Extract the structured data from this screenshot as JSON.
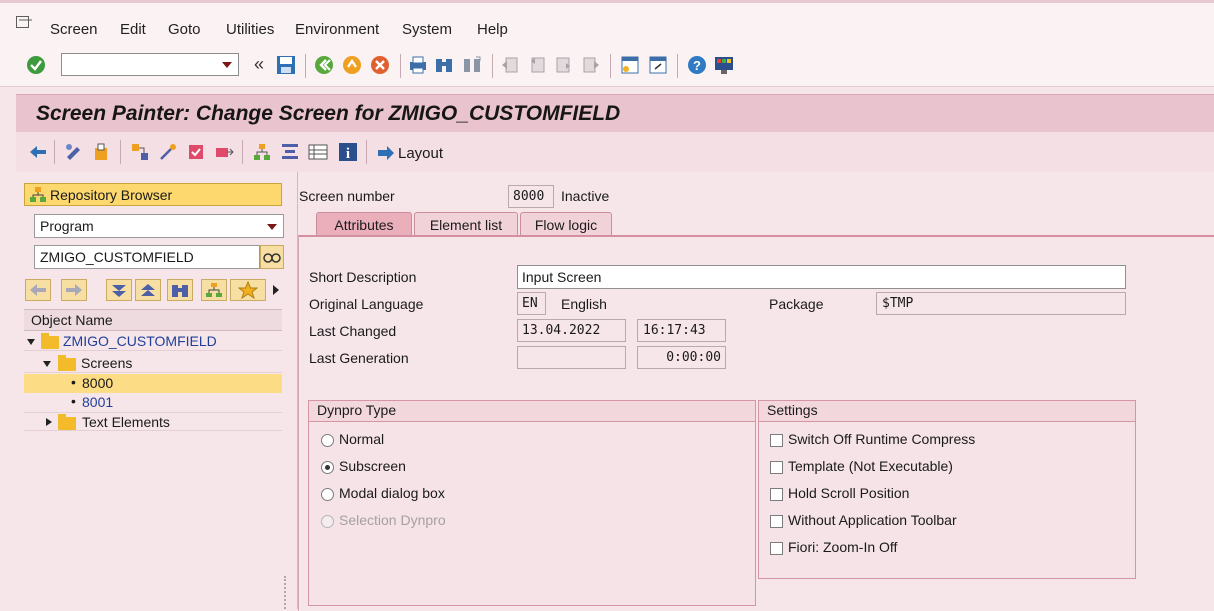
{
  "menu": {
    "items": [
      "Screen",
      "Edit",
      "Goto",
      "Utilities",
      "Environment",
      "System",
      "Help"
    ]
  },
  "system_toolbar": {
    "command_field_value": "",
    "icons": [
      "enter-icon",
      "save-icon",
      "back-icon",
      "exit-icon",
      "cancel-icon",
      "print-icon",
      "find-icon",
      "find-next-icon",
      "first-page-icon",
      "previous-page-icon",
      "next-page-icon",
      "last-page-icon",
      "new-session-icon",
      "shortcut-icon",
      "help-icon",
      "customize-layout-icon"
    ]
  },
  "title": "Screen Painter: Change Screen for ZMIGO_CUSTOMFIELD",
  "app_toolbar": {
    "layout_label": "Layout"
  },
  "left_panel": {
    "repository_browser_label": "Repository Browser",
    "object_type": "Program",
    "object_name_value": "ZMIGO_CUSTOMFIELD",
    "column_header": "Object Name",
    "tree": {
      "root": "ZMIGO_CUSTOMFIELD",
      "screens_label": "Screens",
      "screens": [
        "8000",
        "8001"
      ],
      "text_elements_label": "Text Elements"
    }
  },
  "screen": {
    "number_label": "Screen number",
    "number": "8000",
    "status": "Inactive"
  },
  "tabs": [
    "Attributes",
    "Element list",
    "Flow logic"
  ],
  "attributes": {
    "short_description_label": "Short Description",
    "short_description": "Input Screen",
    "original_language_label": "Original Language",
    "language_code": "EN",
    "language_name": "English",
    "package_label": "Package",
    "package": "$TMP",
    "last_changed_label": "Last Changed",
    "last_changed_date": "13.04.2022",
    "last_changed_time": "16:17:43",
    "last_generation_label": "Last Generation",
    "last_generation_date": "",
    "last_generation_time": "0:00:00"
  },
  "dynpro_type": {
    "title": "Dynpro Type",
    "options": [
      "Normal",
      "Subscreen",
      "Modal dialog box",
      "Selection Dynpro"
    ],
    "selected": "Subscreen"
  },
  "settings": {
    "title": "Settings",
    "options": [
      "Switch Off Runtime Compress",
      "Template (Not Executable)",
      "Hold Scroll Position",
      "Without Application Toolbar",
      "Fiori: Zoom-In Off"
    ]
  },
  "colors": {
    "title_bar": "#e9c3cd",
    "accent_button": "#fcd86f",
    "tree_link": "#1f3f9a"
  }
}
